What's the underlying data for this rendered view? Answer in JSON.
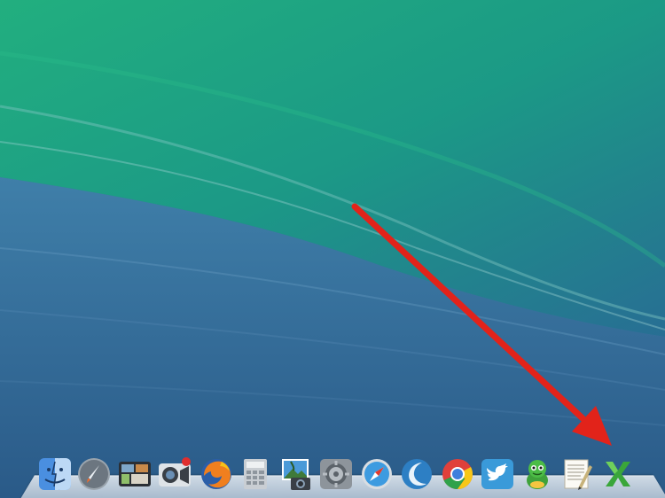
{
  "desktop": {
    "wallpaper": "ocean-wave",
    "colors": {
      "teal": "#1fa57f",
      "deep_blue": "#2d5f8f",
      "mid_blue": "#3d7aa8"
    }
  },
  "dock": {
    "items": [
      {
        "name": "finder-icon"
      },
      {
        "name": "launchpad-icon"
      },
      {
        "name": "mission-control-icon"
      },
      {
        "name": "facetime-icon"
      },
      {
        "name": "firefox-icon"
      },
      {
        "name": "calculator-icon"
      },
      {
        "name": "iphoto-icon"
      },
      {
        "name": "system-preferences-icon"
      },
      {
        "name": "safari-icon"
      },
      {
        "name": "app-crescent-icon"
      },
      {
        "name": "chrome-icon"
      },
      {
        "name": "twitter-icon"
      },
      {
        "name": "adium-icon"
      },
      {
        "name": "textedit-icon"
      },
      {
        "name": "excel-icon"
      }
    ]
  },
  "annotation": {
    "type": "arrow",
    "color": "#e2231a",
    "points_to": "excel-icon"
  }
}
